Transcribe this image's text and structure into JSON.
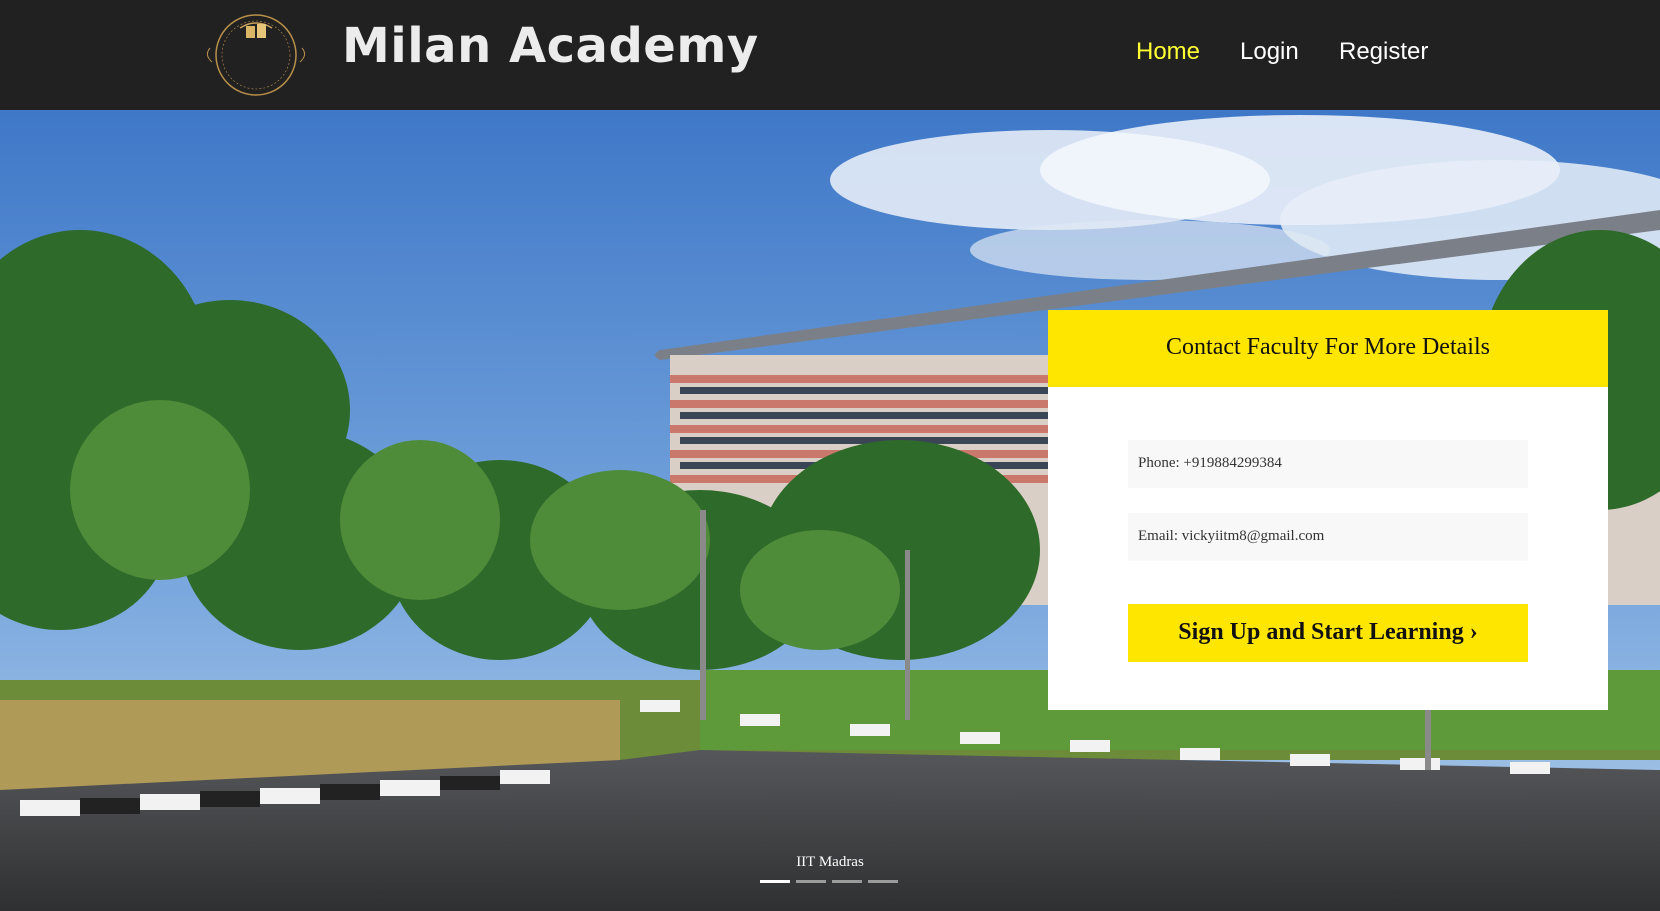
{
  "header": {
    "brand": "Milan Academy",
    "logo_monogram": "ml",
    "logo_ring_text": "MILAN ACADEMY",
    "nav": {
      "home": "Home",
      "login": "Login",
      "register": "Register"
    },
    "active_color": "#ffff33",
    "background": "#212121"
  },
  "hero": {
    "caption": "IIT Madras",
    "slides_total": 4,
    "active_slide": 1
  },
  "contact": {
    "title": "Contact Faculty For More Details",
    "phone": "Phone: +919884299384",
    "email": "Email: vickyiitm8@gmail.com",
    "cta_label": "Sign Up and Start Learning ›",
    "accent_color": "#ffe600"
  }
}
